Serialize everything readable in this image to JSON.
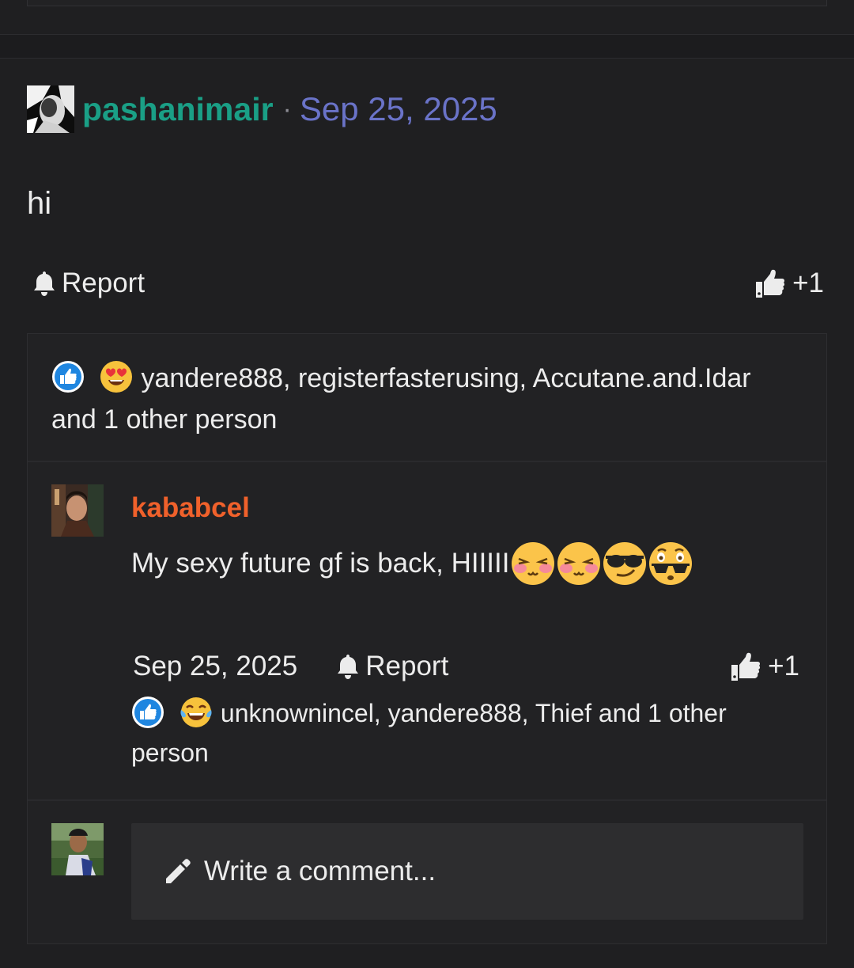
{
  "post": {
    "author": "pashanimair",
    "separator": "·",
    "date": "Sep 25, 2025",
    "body": "hi",
    "report_label": "Report",
    "like_count": "+1",
    "colors": {
      "author": "#1a9f86",
      "date": "#6a73c8"
    }
  },
  "post_reactions": {
    "icons": [
      "thumbs-up-icon",
      "heart-eyes-emoji-icon"
    ],
    "text": "yandere888, registerfasterusing, Accutane.and.Idar and 1 other person"
  },
  "comment": {
    "author": "kababcel",
    "text": "My sexy future gf is back, HIIIII",
    "emojis": [
      "blushing-face-icon",
      "blushing-face-icon",
      "sunglasses-face-icon",
      "sunglasses-flushed-face-icon"
    ],
    "date": "Sep 25, 2025",
    "report_label": "Report",
    "like_count": "+1",
    "reaction_icons": [
      "thumbs-up-icon",
      "crying-laughing-emoji-icon"
    ],
    "reactions_text": "unknownincel, yandere888, Thief and 1 other person",
    "colors": {
      "author": "#f0612b"
    }
  },
  "composer": {
    "placeholder": "Write a comment..."
  }
}
